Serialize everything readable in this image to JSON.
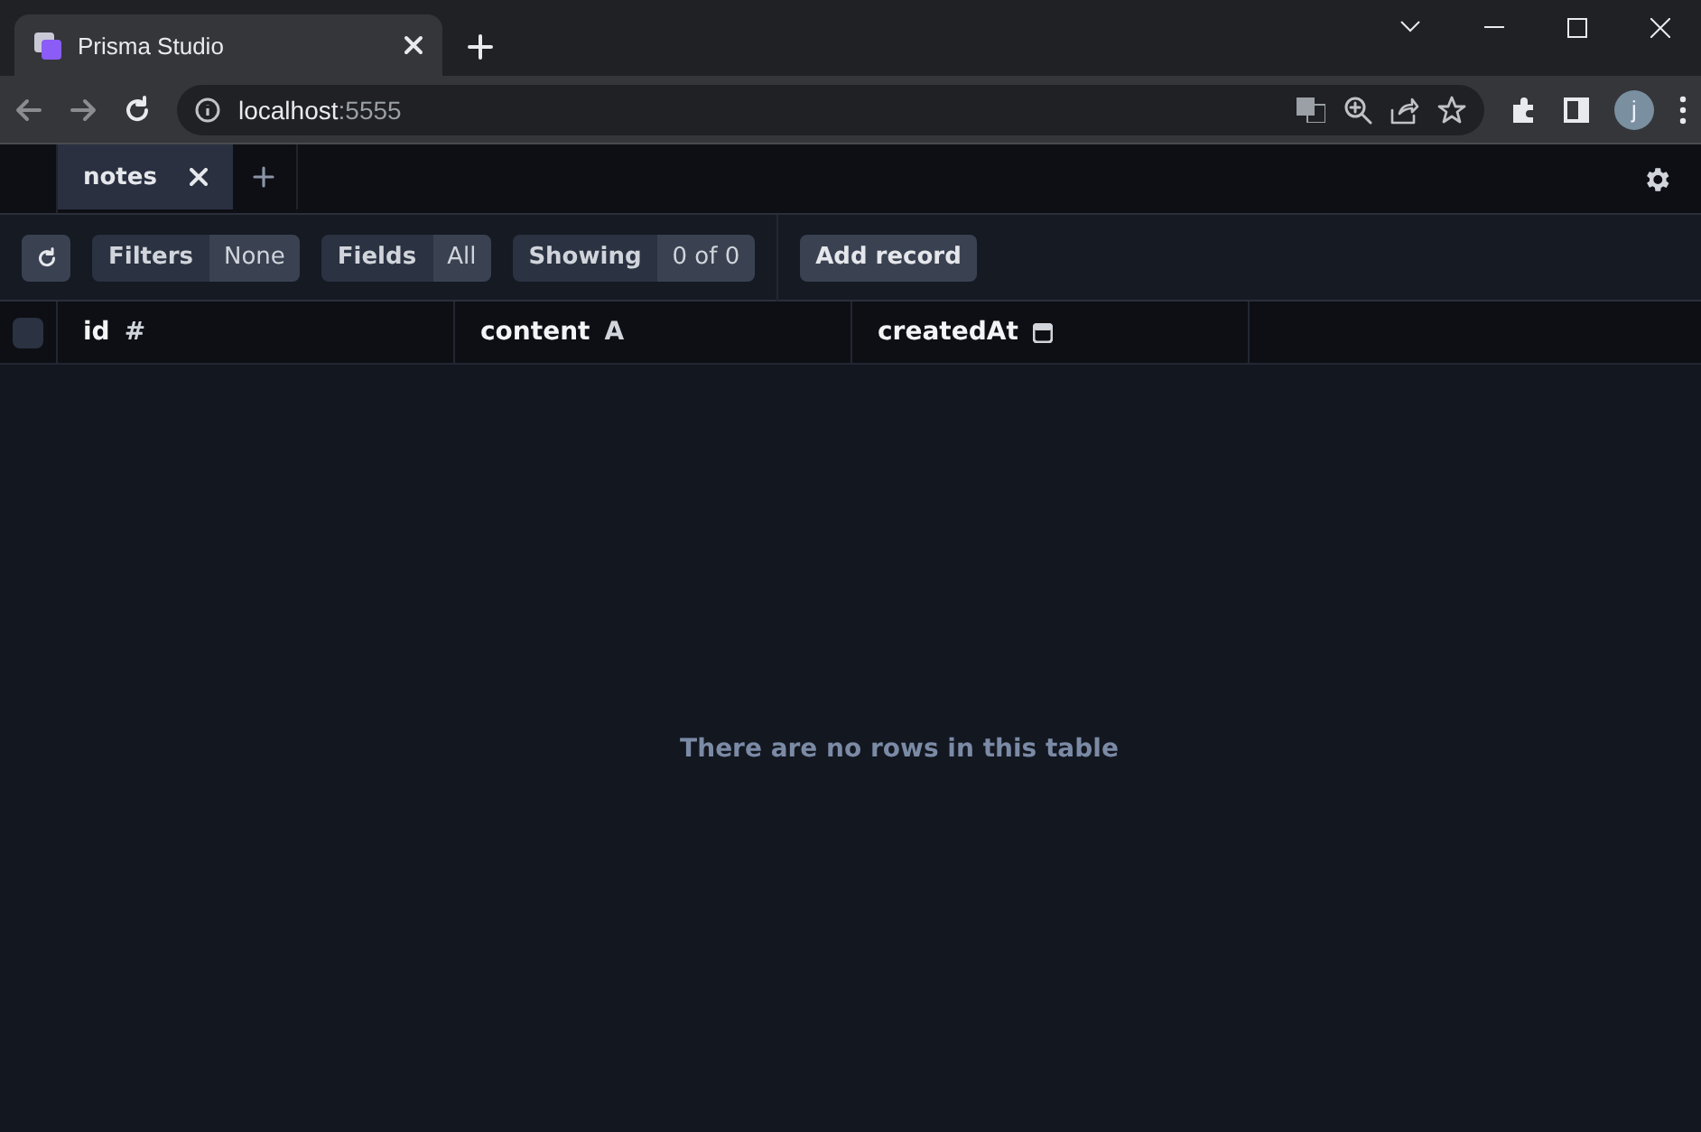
{
  "browser": {
    "tab_title": "Prisma Studio",
    "url_host": "localhost",
    "url_port": ":5555",
    "avatar": "j"
  },
  "tabs": [
    {
      "label": "notes",
      "selected": true
    }
  ],
  "toolbar": {
    "groups": [
      {
        "label": "Filters",
        "value": "None"
      },
      {
        "label": "Fields",
        "value": "All"
      },
      {
        "label": "Showing",
        "value": "0 of 0"
      }
    ],
    "add_button": "Add record"
  },
  "table": {
    "select_all_checked": false,
    "columns": [
      {
        "name": "id",
        "kind": "glyph",
        "glyph": "#"
      },
      {
        "name": "content",
        "kind": "glyph",
        "glyph": "A"
      },
      {
        "name": "createdAt",
        "kind": "date"
      }
    ]
  },
  "empty_message": "There are no rows in this table"
}
